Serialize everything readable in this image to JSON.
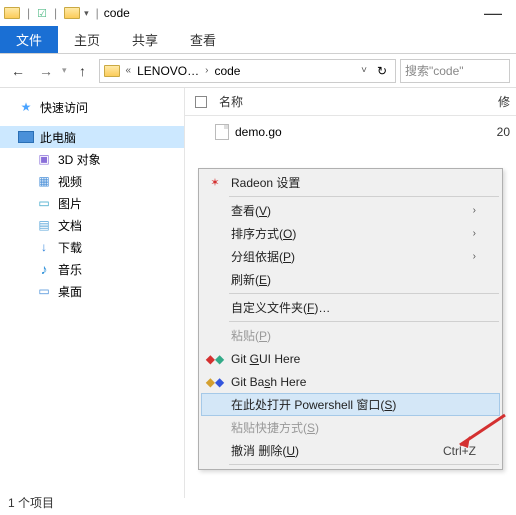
{
  "title": "code",
  "tabs": {
    "file": "文件",
    "home": "主页",
    "share": "共享",
    "view": "查看"
  },
  "address": {
    "root": "LENOVO…",
    "leaf": "code"
  },
  "search_placeholder": "搜索\"code\"",
  "sidebar": {
    "quick": "快速访问",
    "pc": "此电脑",
    "items": [
      "3D 对象",
      "视频",
      "图片",
      "文档",
      "下载",
      "音乐",
      "桌面"
    ]
  },
  "columns": {
    "name": "名称",
    "modified": "修"
  },
  "files": [
    {
      "name": "demo.go",
      "date": "20"
    }
  ],
  "status": "1 个项目",
  "ctx": {
    "radeon": "Radeon 设置",
    "view": "查看(V)",
    "sort": "排序方式(O)",
    "group": "分组依据(P)",
    "refresh": "刷新(E)",
    "customize": "自定义文件夹(F)…",
    "paste": "粘贴(P)",
    "gitgui": "Git GUI Here",
    "gitbash": "Git Bash Here",
    "powershell": "在此处打开 Powershell 窗口(S)",
    "pasteshort": "粘贴快捷方式(S)",
    "undo": "撤消 删除(U)",
    "undo_key": "Ctrl+Z"
  }
}
